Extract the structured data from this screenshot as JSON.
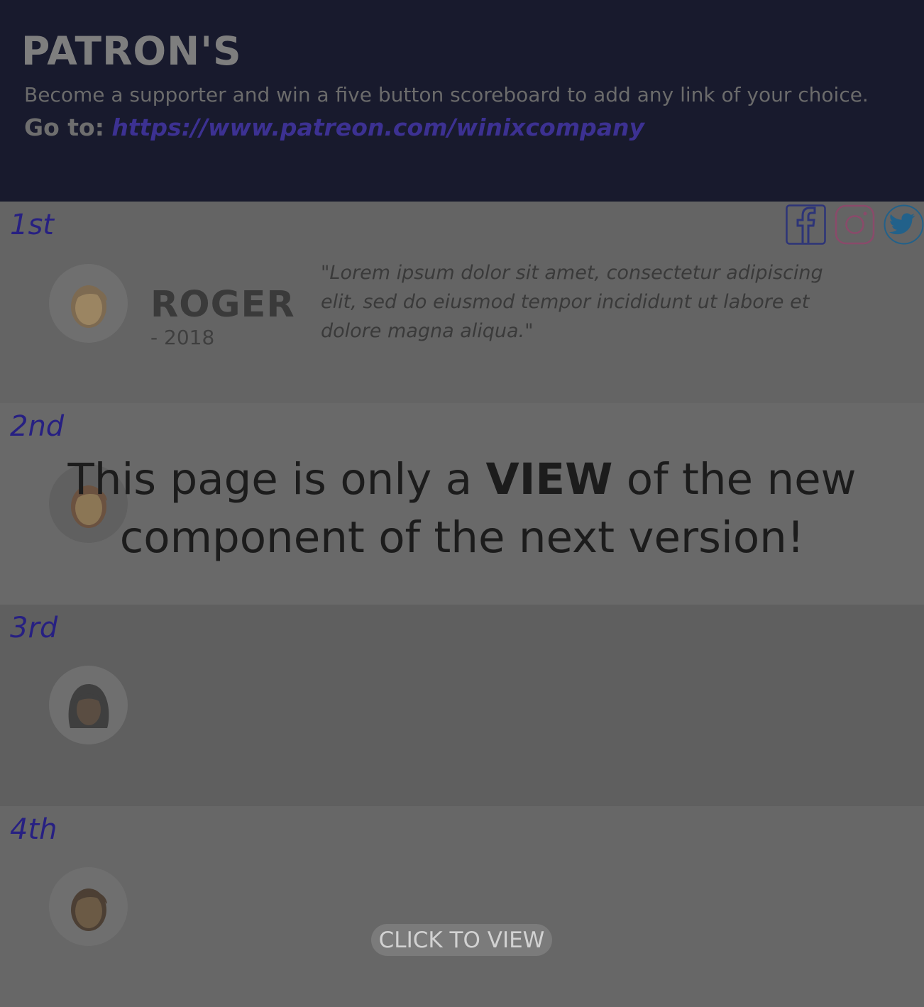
{
  "header": {
    "title": "PATRON'S",
    "subtitle": "Become a supporter and win a five button scoreboard to add any link of your choice.",
    "goto_label": "Go to:",
    "goto_link": "https://www.patreon.com/winixcompany"
  },
  "socials": [
    "facebook-icon",
    "instagram-icon",
    "twitter-icon"
  ],
  "patrons": [
    {
      "rank": "1st",
      "name": "ROGER",
      "year": "- 2018",
      "quote": "\"Lorem ipsum dolor sit amet, consectetur adipiscing elit, sed do eiusmod tempor incididunt ut labore et dolore magna aliqua.\"",
      "avatar": "male-avatar-icon"
    },
    {
      "rank": "2nd",
      "avatar": "male-avatar-icon"
    },
    {
      "rank": "3rd",
      "avatar": "female-avatar-icon"
    },
    {
      "rank": "4th",
      "avatar": "male-avatar-icon"
    }
  ],
  "overlay": {
    "pre": "This page is only a ",
    "strong": "VIEW",
    "post": " of the new component of the next version!"
  },
  "cta_label": "CLICK TO VIEW",
  "colors": {
    "header_bg": "#181a2d",
    "rank_text": "#272082",
    "link": "#3c3192",
    "row_1": "#646464",
    "row_2": "#696969",
    "row_3": "#5f5f5f",
    "row_4": "#676767"
  }
}
